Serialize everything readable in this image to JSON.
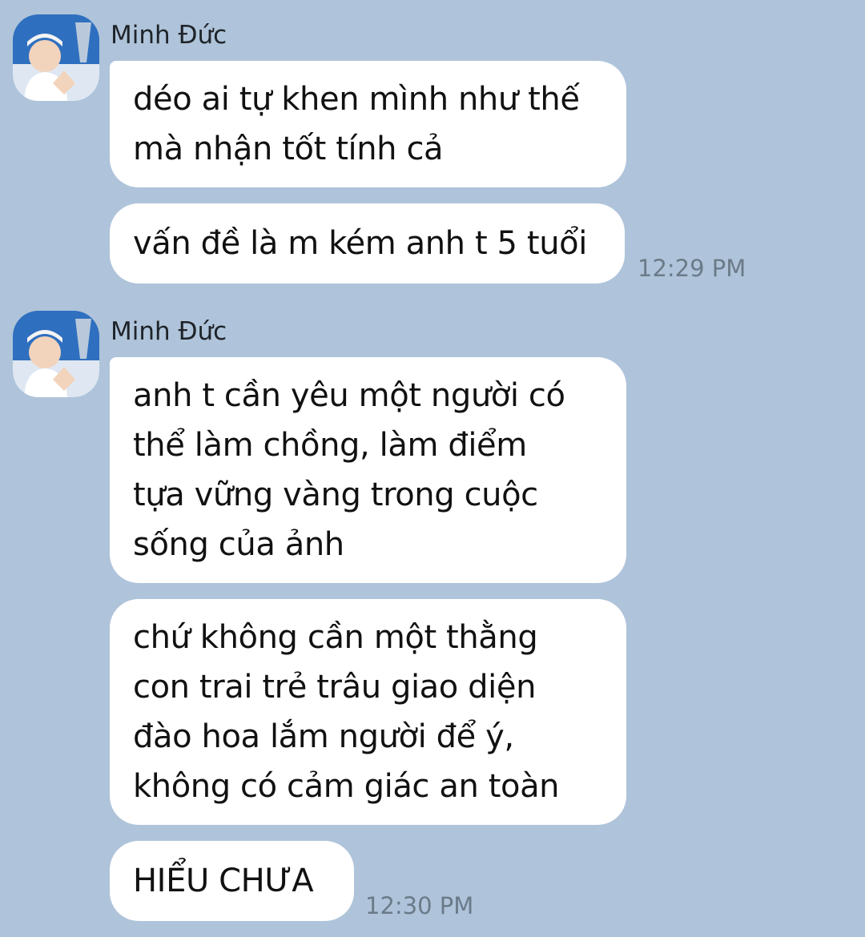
{
  "groups": [
    {
      "sender": "Minh Đức",
      "messages": [
        "déo ai tự khen mình như thế\nmà nhận tốt tính cả",
        "vấn đề là m kém anh t 5 tuổi"
      ],
      "time": "12:29 PM"
    },
    {
      "sender": "Minh Đức",
      "messages": [
        "anh t cần yêu một người có\nthể làm chồng, làm điểm\ntựa vững vàng trong cuộc\nsống của ảnh",
        "chứ không cần một thằng\ncon trai trẻ trâu giao diện\nđào hoa lắm người để ý,\nkhông có cảm giác an toàn",
        "HIỂU CHƯA"
      ],
      "time": "12:30 PM"
    }
  ],
  "icons": {
    "avatar": "contact-avatar-photo"
  },
  "colors": {
    "background": "#afc4da",
    "bubble": "#ffffff",
    "text": "#111111",
    "timestamp": "#6b7a89"
  }
}
